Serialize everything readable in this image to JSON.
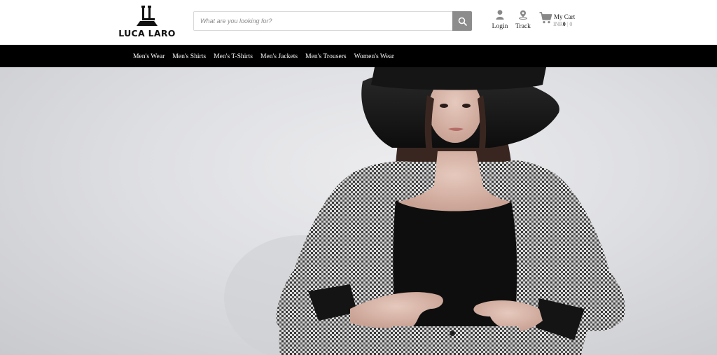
{
  "brand": {
    "name": "LUCA LARO"
  },
  "search": {
    "placeholder": "What are you looking for?"
  },
  "header_actions": {
    "login_label": "Login",
    "track_label": "Track",
    "cart_label": "My Cart",
    "cart_currency": "INR",
    "cart_amount": "0",
    "cart_count": "0"
  },
  "nav": {
    "items": [
      {
        "label": "Men's Wear"
      },
      {
        "label": "Men's Shirts"
      },
      {
        "label": "Men's T-Shirts"
      },
      {
        "label": "Men's Jackets"
      },
      {
        "label": "Men's Trousers"
      },
      {
        "label": "Women's Wear"
      }
    ]
  },
  "icons": {
    "search": "search-icon",
    "login": "user-icon",
    "track": "map-pin-icon",
    "cart": "shopping-cart-icon"
  },
  "colors": {
    "nav_background": "#000000",
    "search_button": "#8c8c8c",
    "header_background": "#ffffff"
  },
  "hero": {
    "alt": "Woman in black wide-brim hat and houndstooth suit"
  }
}
